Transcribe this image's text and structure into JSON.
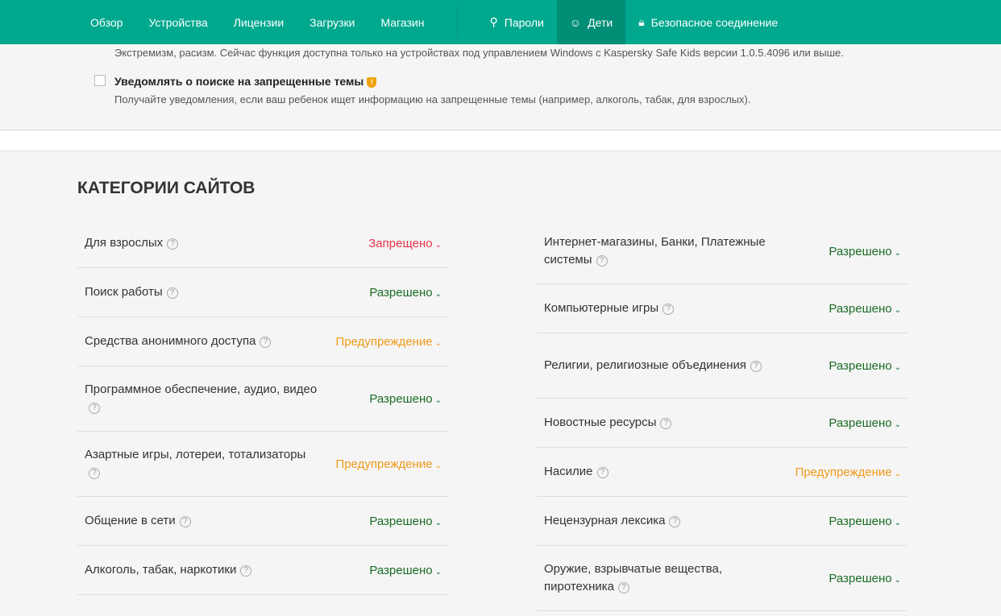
{
  "nav": {
    "left": [
      "Обзор",
      "Устройства",
      "Лицензии",
      "Загрузки",
      "Магазин"
    ],
    "passwords": "Пароли",
    "kids": "Дети",
    "secure": "Безопасное соединение"
  },
  "top": {
    "text1": "Экстремизм, расизм. Сейчас функция доступна только на устройствах под управлением Windows с Kaspersky Safe Kids версии 1.0.5.4096 или выше.",
    "checkbox_label": "Уведомлять о поиске на запрещенные темы",
    "checkbox_desc": "Получайте уведомления, если ваш ребенок ищет информацию на запрещенные темы (например, алкоголь, табак, для взрослых)."
  },
  "section_title": "КАТЕГОРИИ САЙТОВ",
  "colors": {
    "accent": "#00a88e",
    "allowed": "#1a6b24",
    "blocked": "#e8334a",
    "warn": "#f09a1a"
  },
  "left": [
    {
      "name": "Для взрослых",
      "status": "Запрещено",
      "type": "blocked"
    },
    {
      "name": "Поиск работы",
      "status": "Разрешено",
      "type": "allowed"
    },
    {
      "name": "Средства анонимного доступа",
      "status": "Предупреждение",
      "type": "warn"
    },
    {
      "name": "Программное обеспечение, аудио, видео",
      "status": "Разрешено",
      "type": "allowed",
      "two": true
    },
    {
      "name": "Азартные игры, лотереи, тотализаторы",
      "status": "Предупреждение",
      "type": "warn",
      "two": true
    },
    {
      "name": "Общение в сети",
      "status": "Разрешено",
      "type": "allowed"
    },
    {
      "name": "Алкоголь, табак, наркотики",
      "status": "Разрешено",
      "type": "allowed"
    }
  ],
  "right": [
    {
      "name": "Интернет-магазины, Банки, Платежные системы",
      "status": "Разрешено",
      "type": "allowed",
      "two": true
    },
    {
      "name": "Компьютерные игры",
      "status": "Разрешено",
      "type": "allowed"
    },
    {
      "name": "Религии, религиозные объединения",
      "status": "Разрешено",
      "type": "allowed",
      "two": true
    },
    {
      "name": "Новостные ресурсы",
      "status": "Разрешено",
      "type": "allowed"
    },
    {
      "name": "Насилие",
      "status": "Предупреждение",
      "type": "warn"
    },
    {
      "name": "Нецензурная лексика",
      "status": "Разрешено",
      "type": "allowed"
    },
    {
      "name": "Оружие, взрывчатые вещества, пиротехника",
      "status": "Разрешено",
      "type": "allowed",
      "two": true
    }
  ]
}
